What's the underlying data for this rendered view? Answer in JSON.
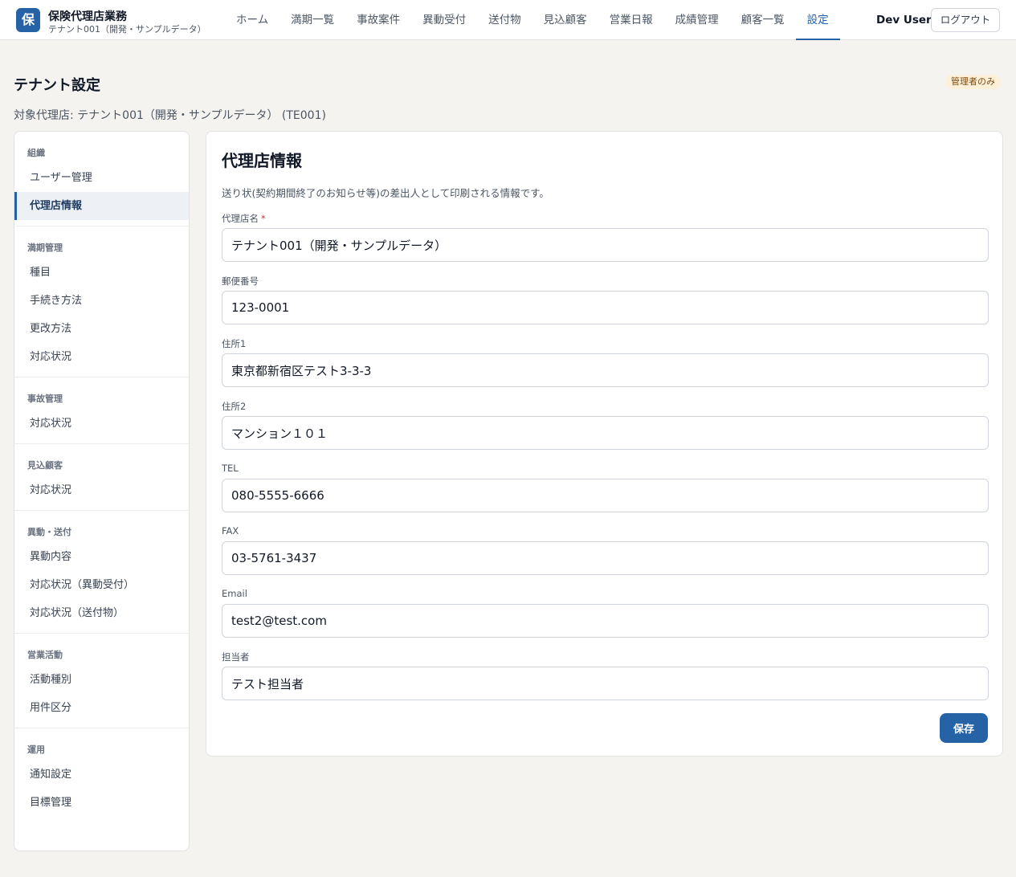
{
  "app": {
    "logo_char": "保",
    "title": "保険代理店業務",
    "subtitle": "テナント001（開発・サンプルデータ）"
  },
  "nav": {
    "items": [
      "ホーム",
      "満期一覧",
      "事故案件",
      "異動受付",
      "送付物",
      "見込顧客",
      "営業日報",
      "成績管理",
      "顧客一覧",
      "設定"
    ],
    "active": "設定"
  },
  "user": {
    "name": "Dev User",
    "logout_label": "ログアウト"
  },
  "page": {
    "title": "テナント設定",
    "badge": "管理者のみ",
    "target": "対象代理店: テナント001（開発・サンプルデータ） (TE001)"
  },
  "sidebar": {
    "sections": [
      {
        "heading": "組織",
        "items": [
          "ユーザー管理",
          "代理店情報"
        ]
      },
      {
        "heading": "満期管理",
        "items": [
          "種目",
          "手続き方法",
          "更改方法",
          "対応状況"
        ]
      },
      {
        "heading": "事故管理",
        "items": [
          "対応状況"
        ]
      },
      {
        "heading": "見込顧客",
        "items": [
          "対応状況"
        ]
      },
      {
        "heading": "異動・送付",
        "items": [
          "異動内容",
          "対応状況（異動受付）",
          "対応状況（送付物）"
        ]
      },
      {
        "heading": "営業活動",
        "items": [
          "活動種別",
          "用件区分"
        ]
      },
      {
        "heading": "運用",
        "items": [
          "通知設定",
          "目標管理"
        ]
      }
    ],
    "active_item": "代理店情報"
  },
  "form": {
    "title": "代理店情報",
    "description": "送り状(契約期間終了のお知らせ等)の差出人として印刷される情報です。",
    "fields": [
      {
        "label": "代理店名",
        "required": true,
        "value": "テナント001（開発・サンプルデータ）"
      },
      {
        "label": "郵便番号",
        "required": false,
        "value": "123-0001"
      },
      {
        "label": "住所1",
        "required": false,
        "value": "東京都新宿区テスト3-3-3"
      },
      {
        "label": "住所2",
        "required": false,
        "value": "マンション１０１"
      },
      {
        "label": "TEL",
        "required": false,
        "value": "080-5555-6666"
      },
      {
        "label": "FAX",
        "required": false,
        "value": "03-5761-3437"
      },
      {
        "label": "Email",
        "required": false,
        "value": "test2@test.com"
      },
      {
        "label": "担当者",
        "required": false,
        "value": "テスト担当者"
      }
    ],
    "required_mark": "*",
    "save_label": "保存"
  },
  "colors": {
    "accent": "#2563a6",
    "background": "#f4f3ef",
    "badge_bg": "#fdf0d8",
    "required": "#c0392b"
  }
}
